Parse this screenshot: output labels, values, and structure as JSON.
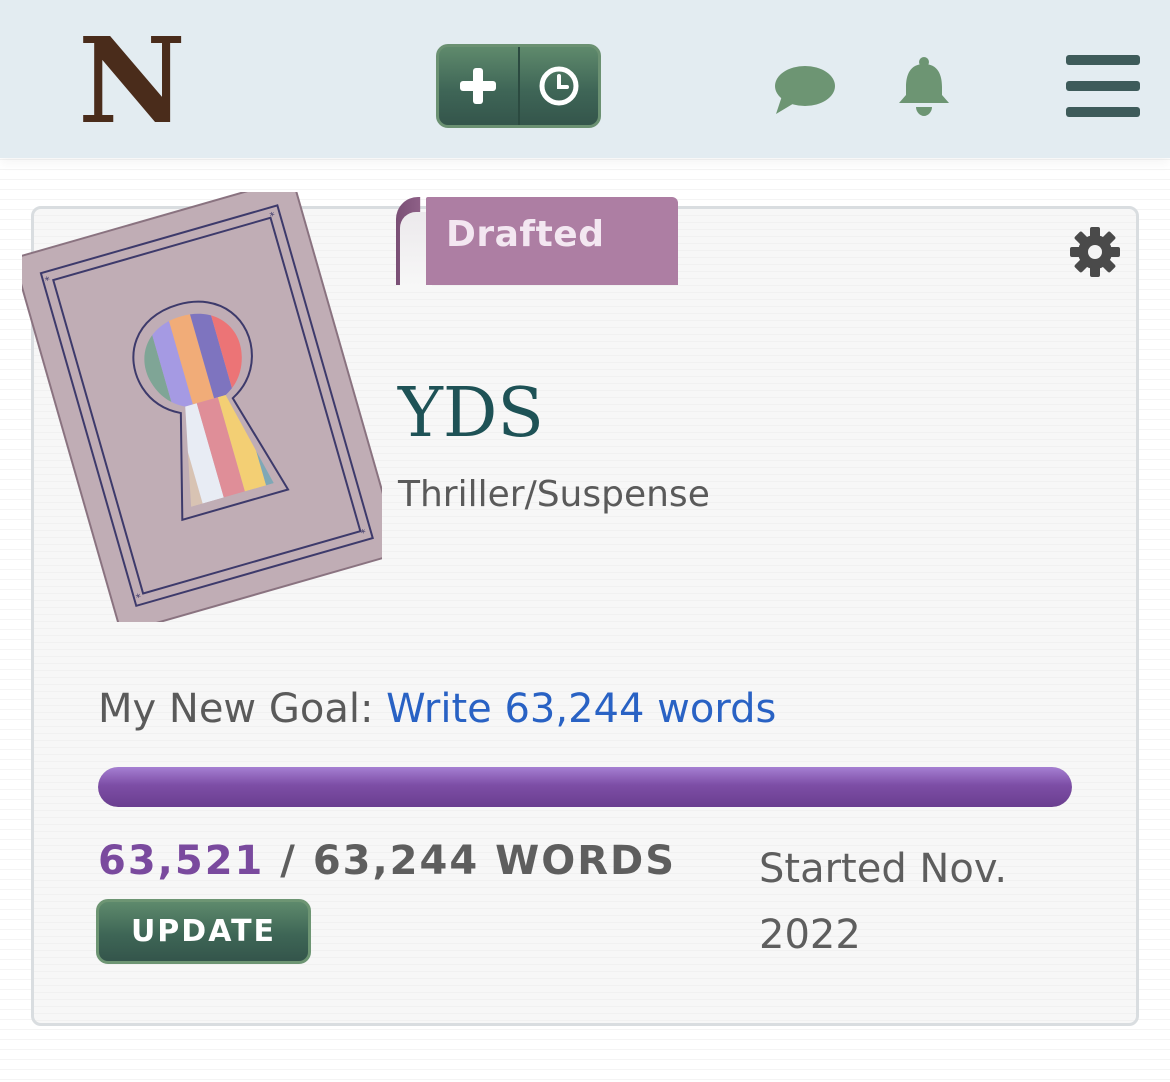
{
  "header": {
    "logo_text": "N",
    "new_button_icon": "plus-icon",
    "timer_button_icon": "clock-icon",
    "chat_icon": "chat-bubble-icon",
    "notifications_icon": "bell-icon",
    "menu_icon": "hamburger-menu-icon"
  },
  "project": {
    "status_badge": "Drafted",
    "title": "YDS",
    "genre": "Thriller/Suspense",
    "goal_label": "My New Goal:",
    "goal_link": "Write 63,244 words",
    "progress_fraction": 1.0,
    "word_count_current": "63,521",
    "word_count_separator": " / 63,244 WORDS",
    "update_button": "UPDATE",
    "started_text": "Started Nov. 2022"
  },
  "colors": {
    "header_bg": "#e3ecf1",
    "logo": "#4a2c1b",
    "accent_green": "#3f6657",
    "badge_purple": "#ad7ea3",
    "progress_purple": "#7d4ea6",
    "link_blue": "#2962c4",
    "title_teal": "#1e5256"
  }
}
